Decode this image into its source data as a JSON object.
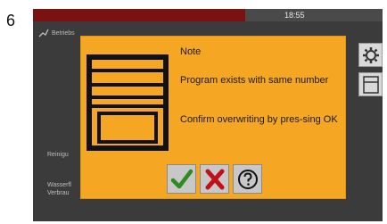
{
  "step": {
    "number": "6"
  },
  "status_bar": {
    "time": "18:55"
  },
  "background": {
    "title": "Betriebs",
    "left_label_1": "Reinigu",
    "left_label_2": "Wasserfl",
    "left_label_3": "Verbrau"
  },
  "dialog": {
    "title": "Note",
    "message_line1": "Program exists with same number",
    "message_line2": "Confirm overwriting by pres-sing OK",
    "ok_icon": "check-icon",
    "cancel_icon": "x-icon",
    "help_icon": "question-icon"
  },
  "colors": {
    "dialog_bg": "#f5a623",
    "ok_green": "#2e8b1f",
    "cancel_red": "#c0101a",
    "status_red": "#7a1212"
  }
}
